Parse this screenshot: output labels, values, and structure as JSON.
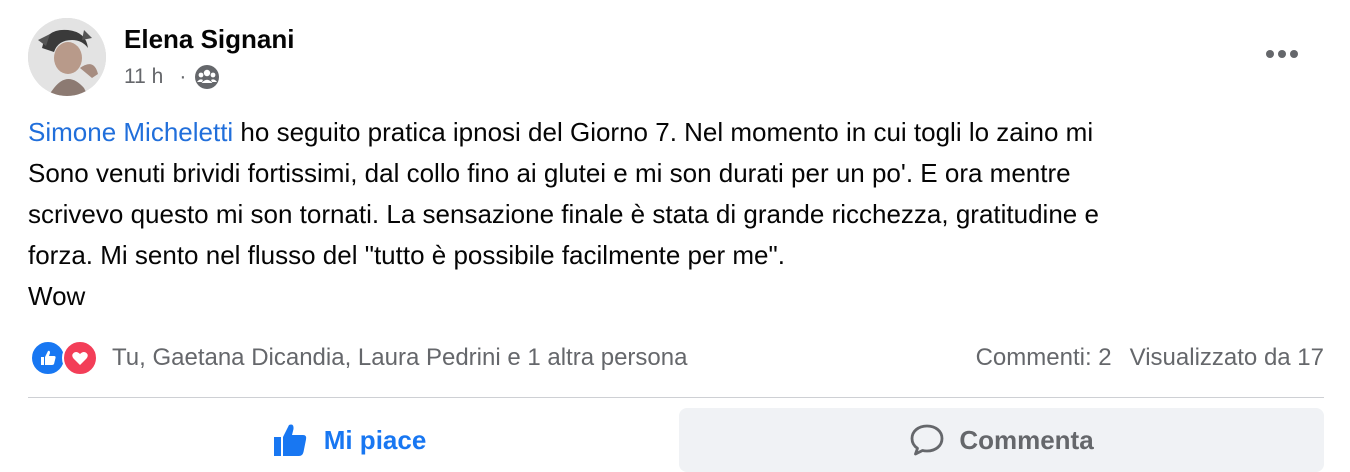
{
  "post": {
    "author": "Elena Signani",
    "time": "11 h",
    "separator": "·",
    "audience_icon": "friends-icon",
    "mention": "Simone Micheletti",
    "text_lines": [
      " ho seguito pratica ipnosi del Giorno 7. Nel momento in cui togli lo zaino mi",
      "Sono venuti brividi fortissimi, dal collo fino ai glutei e mi son durati per un po'. E ora mentre",
      "scrivevo questo mi son tornati. La sensazione finale è stata di grande ricchezza, gratitudine e",
      "forza. Mi sento nel flusso del \"tutto è possibile facilmente per me\".",
      "Wow"
    ]
  },
  "reactions": {
    "icons": [
      "like-icon",
      "love-icon"
    ],
    "summary": "Tu, Gaetana Dicandia, Laura Pedrini e 1 altra persona",
    "comments": "Commenti: 2",
    "views": "Visualizzato da 17"
  },
  "actions": {
    "like_label": "Mi piace",
    "comment_label": "Commenta"
  },
  "colors": {
    "accent": "#1877f2",
    "mention": "#216fdb",
    "secondary_text": "#65676b",
    "love": "#f33e58"
  }
}
